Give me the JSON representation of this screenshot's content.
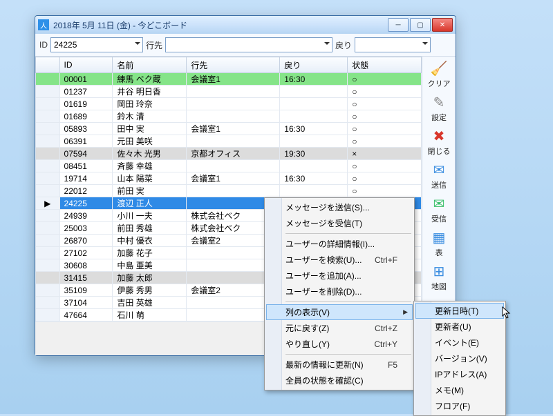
{
  "window": {
    "title": "2018年 5月 11日 (金) - 今どこボード"
  },
  "toolbar": {
    "id_label": "ID",
    "id_value": "24225",
    "dest_label": "行先",
    "dest_value": "",
    "return_label": "戻り",
    "return_value": ""
  },
  "columns": [
    "",
    "ID",
    "名前",
    "行先",
    "戻り",
    "状態"
  ],
  "rows": [
    {
      "id": "00001",
      "name": "練馬 ベク蔵",
      "dest": "会議室1",
      "ret": "16:30",
      "state": "○",
      "cls": "green"
    },
    {
      "id": "01237",
      "name": "井谷 明日香",
      "dest": "",
      "ret": "",
      "state": "○",
      "cls": ""
    },
    {
      "id": "01619",
      "name": "岡田 玲奈",
      "dest": "",
      "ret": "",
      "state": "○",
      "cls": ""
    },
    {
      "id": "01689",
      "name": "鈴木 清",
      "dest": "",
      "ret": "",
      "state": "○",
      "cls": ""
    },
    {
      "id": "05893",
      "name": "田中 実",
      "dest": "会議室1",
      "ret": "16:30",
      "state": "○",
      "cls": ""
    },
    {
      "id": "06391",
      "name": "元田 美咲",
      "dest": "",
      "ret": "",
      "state": "○",
      "cls": ""
    },
    {
      "id": "07594",
      "name": "佐々木 光男",
      "dest": "京都オフィス",
      "ret": "19:30",
      "state": "×",
      "cls": "gray"
    },
    {
      "id": "08451",
      "name": "斉藤 幸雄",
      "dest": "",
      "ret": "",
      "state": "○",
      "cls": ""
    },
    {
      "id": "19714",
      "name": "山本 陽菜",
      "dest": "会議室1",
      "ret": "16:30",
      "state": "○",
      "cls": ""
    },
    {
      "id": "22012",
      "name": "前田 実",
      "dest": "",
      "ret": "",
      "state": "○",
      "cls": ""
    },
    {
      "id": "24225",
      "name": "渡辺 正人",
      "dest": "",
      "ret": "",
      "state": "○",
      "cls": "sel",
      "ptr": true
    },
    {
      "id": "24939",
      "name": "小川 一夫",
      "dest": "株式会社ベク",
      "ret": "",
      "state": "",
      "cls": ""
    },
    {
      "id": "25003",
      "name": "前田 秀雄",
      "dest": "株式会社ベク",
      "ret": "",
      "state": "",
      "cls": ""
    },
    {
      "id": "26870",
      "name": "中村 優衣",
      "dest": "会議室2",
      "ret": "",
      "state": "",
      "cls": ""
    },
    {
      "id": "27102",
      "name": "加藤 花子",
      "dest": "",
      "ret": "",
      "state": "",
      "cls": ""
    },
    {
      "id": "30608",
      "name": "中島 亜美",
      "dest": "",
      "ret": "",
      "state": "",
      "cls": ""
    },
    {
      "id": "31415",
      "name": "加藤 太郎",
      "dest": "",
      "ret": "",
      "state": "",
      "cls": "gray"
    },
    {
      "id": "35109",
      "name": "伊藤 秀男",
      "dest": "会議室2",
      "ret": "",
      "state": "",
      "cls": ""
    },
    {
      "id": "37104",
      "name": "吉田 英雄",
      "dest": "",
      "ret": "",
      "state": "",
      "cls": ""
    },
    {
      "id": "47664",
      "name": "石川 萌",
      "dest": "",
      "ret": "",
      "state": "",
      "cls": ""
    }
  ],
  "sidebar": [
    {
      "name": "clear",
      "label": "クリア",
      "color": "#f7c437",
      "glyph": "🧹"
    },
    {
      "name": "settings",
      "label": "設定",
      "color": "#888",
      "glyph": "✎"
    },
    {
      "name": "close",
      "label": "閉じる",
      "color": "#d8362b",
      "glyph": "✖"
    },
    {
      "name": "send",
      "label": "送信",
      "color": "#3a8de0",
      "glyph": "✉"
    },
    {
      "name": "receive",
      "label": "受信",
      "color": "#3ac06a",
      "glyph": "✉"
    },
    {
      "name": "table",
      "label": "表",
      "color": "#3a8de0",
      "glyph": "▦"
    },
    {
      "name": "map",
      "label": "地図",
      "color": "#3a8de0",
      "glyph": "⊞"
    }
  ],
  "contextmenu": [
    {
      "label": "メッセージを送信(S)...",
      "type": "item"
    },
    {
      "label": "メッセージを受信(T)",
      "type": "item"
    },
    {
      "type": "sep"
    },
    {
      "label": "ユーザーの詳細情報(I)...",
      "type": "item"
    },
    {
      "label": "ユーザーを検索(U)...",
      "shortcut": "Ctrl+F",
      "type": "item"
    },
    {
      "label": "ユーザーを追加(A)...",
      "type": "item"
    },
    {
      "label": "ユーザーを削除(D)...",
      "type": "item"
    },
    {
      "type": "sep"
    },
    {
      "label": "列の表示(V)",
      "type": "item",
      "hot": true,
      "sub": true
    },
    {
      "label": "元に戻す(Z)",
      "shortcut": "Ctrl+Z",
      "type": "item"
    },
    {
      "label": "やり直し(Y)",
      "shortcut": "Ctrl+Y",
      "type": "item"
    },
    {
      "type": "sep"
    },
    {
      "label": "最新の情報に更新(N)",
      "shortcut": "F5",
      "type": "item"
    },
    {
      "label": "全員の状態を確認(C)",
      "type": "item"
    }
  ],
  "submenu": [
    {
      "label": "更新日時(T)",
      "hot": true
    },
    {
      "label": "更新者(U)"
    },
    {
      "label": "イベント(E)"
    },
    {
      "label": "バージョン(V)"
    },
    {
      "label": "IPアドレス(A)"
    },
    {
      "label": "メモ(M)"
    },
    {
      "label": "フロア(F)"
    }
  ]
}
